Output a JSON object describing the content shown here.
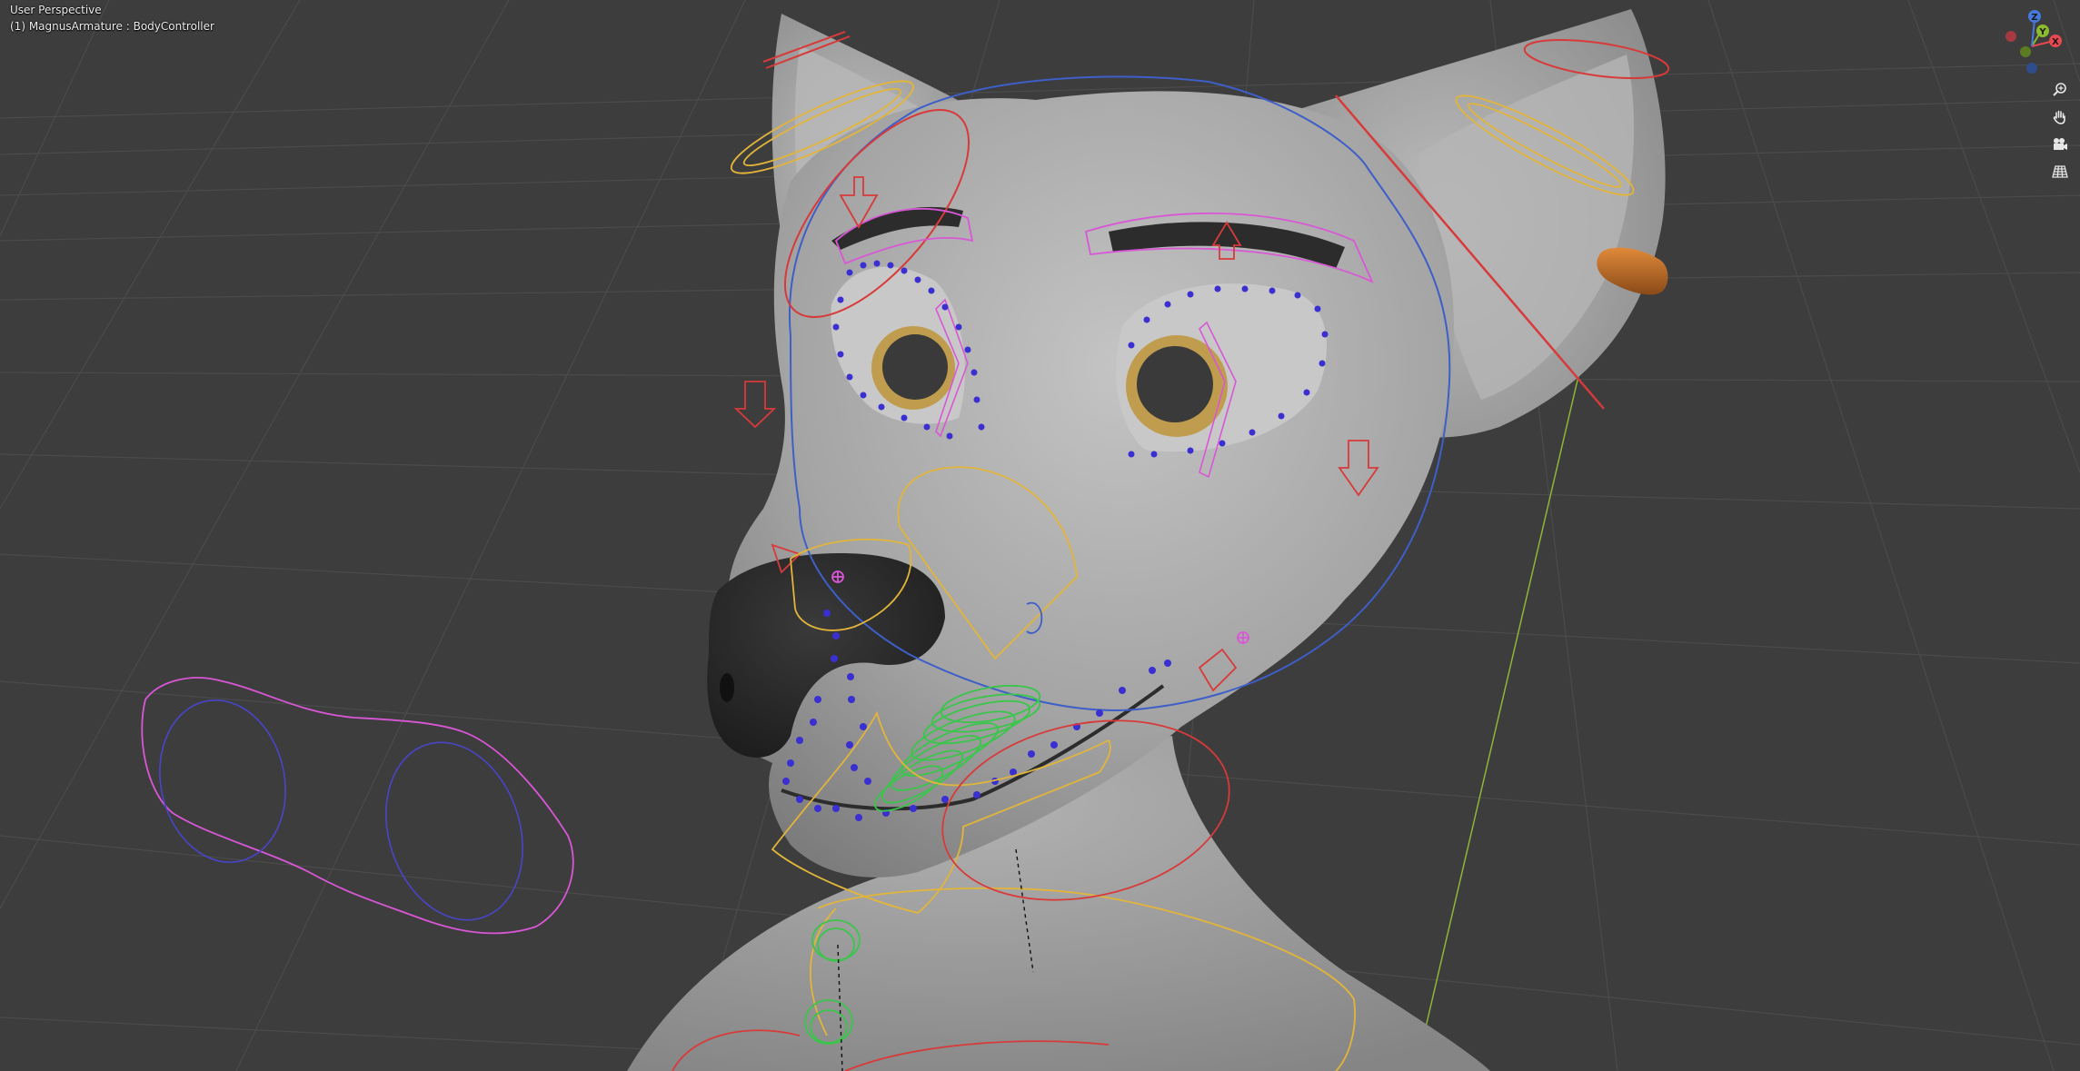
{
  "viewport": {
    "view_name": "User Perspective",
    "active_object": "(1) MagnusArmature : BodyController",
    "background_color": "#3d3d3d",
    "grid_color": "#4b4b4b",
    "floor_axis_color": "#8fb637"
  },
  "gizmo": {
    "x_label": "X",
    "y_label": "Y",
    "z_label": "Z",
    "x_color": "#e8484f",
    "y_color": "#8cbc2c",
    "z_color": "#4779dd"
  },
  "nav_buttons": [
    {
      "name": "zoom",
      "icon": "magnifier-plus-icon"
    },
    {
      "name": "pan",
      "icon": "hand-icon"
    },
    {
      "name": "camera",
      "icon": "camera-icon"
    },
    {
      "name": "ortho",
      "icon": "grid-icon"
    }
  ],
  "model": {
    "name": "MagnusArmature",
    "skin_color": "#a9a9a9",
    "nose_color": "#2b2b2c",
    "iris_color": "#c09d4e",
    "earring_color": "#c8772c"
  },
  "rig_colors": {
    "yellow": "#e2b53a",
    "red": "#d83a3a",
    "blue": "#3e5ec8",
    "pink": "#d957d6",
    "green": "#39c64a",
    "bone_blue": "#3a2fd0"
  }
}
